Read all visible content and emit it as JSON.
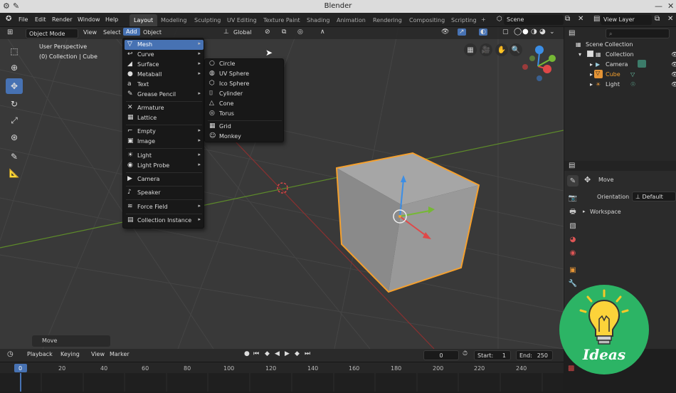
{
  "app": {
    "title": "Blender"
  },
  "topmenu": [
    "File",
    "Edit",
    "Render",
    "Window",
    "Help"
  ],
  "workspace_tabs": [
    {
      "label": "Layout",
      "active": true
    },
    {
      "label": "Modeling"
    },
    {
      "label": "Sculpting"
    },
    {
      "label": "UV Editing"
    },
    {
      "label": "Texture Paint"
    },
    {
      "label": "Shading"
    },
    {
      "label": "Animation"
    },
    {
      "label": "Rendering"
    },
    {
      "label": "Compositing"
    },
    {
      "label": "Scripting"
    }
  ],
  "scene": {
    "label": "Scene",
    "view_layer": "View Layer"
  },
  "viewport_header": {
    "mode": "Object Mode",
    "menus": [
      "View",
      "Select",
      "Add",
      "Object"
    ],
    "orientation": "Global"
  },
  "viewport": {
    "view_name": "User Perspective",
    "collection_info": "(0) Collection | Cube",
    "last_op": "Move"
  },
  "add_menu": {
    "items": [
      {
        "label": "Mesh",
        "icon": "mesh-icon",
        "glyph": "▽",
        "has_sub": true,
        "highlighted": true
      },
      {
        "label": "Curve",
        "icon": "curve-icon",
        "glyph": "↩",
        "has_sub": true
      },
      {
        "label": "Surface",
        "icon": "surface-icon",
        "glyph": "◢",
        "has_sub": true
      },
      {
        "label": "Metaball",
        "icon": "metaball-icon",
        "glyph": "●",
        "has_sub": true
      },
      {
        "label": "Text",
        "icon": "text-icon",
        "glyph": "a",
        "has_sub": false
      },
      {
        "label": "Grease Pencil",
        "icon": "grease-pencil-icon",
        "glyph": "✎",
        "has_sub": true
      },
      {
        "label": "Armature",
        "icon": "armature-icon",
        "glyph": "✕",
        "has_sub": false
      },
      {
        "label": "Lattice",
        "icon": "lattice-icon",
        "glyph": "▦",
        "has_sub": false
      },
      {
        "label": "Empty",
        "icon": "empty-icon",
        "glyph": "⌐",
        "has_sub": true
      },
      {
        "label": "Image",
        "icon": "image-icon",
        "glyph": "▣",
        "has_sub": true
      },
      {
        "label": "Light",
        "icon": "light-icon",
        "glyph": "☀",
        "has_sub": true
      },
      {
        "label": "Light Probe",
        "icon": "light-probe-icon",
        "glyph": "◉",
        "has_sub": true
      },
      {
        "label": "Camera",
        "icon": "camera-icon",
        "glyph": "▶",
        "has_sub": false
      },
      {
        "label": "Speaker",
        "icon": "speaker-icon",
        "glyph": "♪",
        "has_sub": false
      },
      {
        "label": "Force Field",
        "icon": "force-field-icon",
        "glyph": "≋",
        "has_sub": true
      },
      {
        "label": "Collection Instance",
        "icon": "collection-instance-icon",
        "glyph": "▤",
        "has_sub": true
      }
    ]
  },
  "mesh_menu": {
    "items": [
      {
        "label": "Circle",
        "icon": "circle-icon",
        "glyph": "○"
      },
      {
        "label": "UV Sphere",
        "icon": "uv-sphere-icon",
        "glyph": "◍"
      },
      {
        "label": "Ico Sphere",
        "icon": "ico-sphere-icon",
        "glyph": "⬡"
      },
      {
        "label": "Cylinder",
        "icon": "cylinder-icon",
        "glyph": "⌷"
      },
      {
        "label": "Cone",
        "icon": "cone-icon",
        "glyph": "△"
      },
      {
        "label": "Torus",
        "icon": "torus-icon",
        "glyph": "◎"
      },
      {
        "label": "Grid",
        "icon": "grid-icon",
        "glyph": "▦"
      },
      {
        "label": "Monkey",
        "icon": "monkey-icon",
        "glyph": "☺"
      }
    ]
  },
  "outliner": {
    "root": "Scene Collection",
    "collection": "Collection",
    "items": [
      "Camera",
      "Cube",
      "Light"
    ]
  },
  "properties": {
    "tool": "Move",
    "orientation_label": "Orientation",
    "orientation_value": "Default",
    "workspace": "Workspace"
  },
  "timeline": {
    "menus": [
      "Playback",
      "Keying",
      "View",
      "Marker"
    ],
    "current_frame": "0",
    "start_label": "Start:",
    "start": "1",
    "end_label": "End:",
    "end": "250",
    "ticks": [
      "0",
      "20",
      "40",
      "60",
      "80",
      "100",
      "120",
      "140",
      "160",
      "180",
      "200",
      "220",
      "240"
    ]
  },
  "watermark": {
    "text": "Ideas"
  },
  "colors": {
    "accent": "#4772b3",
    "selection": "#f5a02d",
    "watermark_bg": "#2cb465"
  }
}
